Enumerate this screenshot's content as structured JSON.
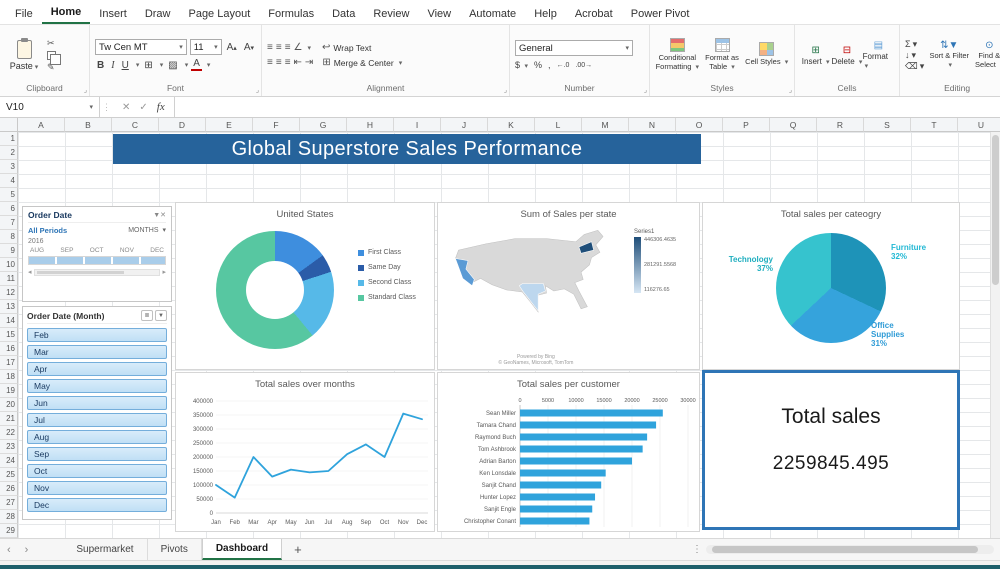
{
  "ribbon": {
    "tabs": [
      {
        "label": "File",
        "active": false
      },
      {
        "label": "Home",
        "active": true
      },
      {
        "label": "Insert",
        "active": false
      },
      {
        "label": "Draw",
        "active": false
      },
      {
        "label": "Page Layout",
        "active": false
      },
      {
        "label": "Formulas",
        "active": false
      },
      {
        "label": "Data",
        "active": false
      },
      {
        "label": "Review",
        "active": false
      },
      {
        "label": "View",
        "active": false
      },
      {
        "label": "Automate",
        "active": false
      },
      {
        "label": "Help",
        "active": false
      },
      {
        "label": "Acrobat",
        "active": false
      },
      {
        "label": "Power Pivot",
        "active": false
      }
    ],
    "clipboard": {
      "paste_label": "Paste",
      "group_label": "Clipboard"
    },
    "font": {
      "font_name": "Tw Cen MT",
      "font_size": "11",
      "group_label": "Font"
    },
    "alignment": {
      "wrap_text_label": "Wrap Text",
      "merge_center_label": "Merge & Center",
      "group_label": "Alignment"
    },
    "number": {
      "format_value": "General",
      "group_label": "Number"
    },
    "styles": {
      "conditional_label": "Conditional Formatting",
      "format_table_label": "Format as Table",
      "cell_styles_label": "Cell Styles",
      "group_label": "Styles"
    },
    "cells": {
      "insert_label": "Insert",
      "delete_label": "Delete",
      "format_label": "Format",
      "group_label": "Cells"
    },
    "editing": {
      "sort_filter_label": "Sort & Filter",
      "find_select_label": "Find & Select",
      "group_label": "Editing"
    }
  },
  "formula_bar": {
    "name_box_value": "V10",
    "fx_label": "fx"
  },
  "grid": {
    "columns": [
      "A",
      "B",
      "C",
      "D",
      "E",
      "F",
      "G",
      "H",
      "I",
      "J",
      "K",
      "L",
      "M",
      "N",
      "O",
      "P",
      "Q",
      "R",
      "S",
      "T",
      "U"
    ],
    "row_count": 29
  },
  "dashboard": {
    "banner_title": "Global Superstore Sales Performance",
    "timeline": {
      "title": "Order Date",
      "period_label": "All Periods",
      "level_label": "MONTHS",
      "year_label": "2016",
      "months": [
        "AUG",
        "SEP",
        "OCT",
        "NOV",
        "DEC"
      ]
    },
    "slicer": {
      "title": "Order Date (Month)",
      "items": [
        "Feb",
        "Mar",
        "Apr",
        "May",
        "Jun",
        "Jul",
        "Aug",
        "Sep",
        "Oct",
        "Nov",
        "Dec"
      ]
    },
    "total_card": {
      "title": "Total sales",
      "value": "2259845.495"
    }
  },
  "chart_data": [
    {
      "type": "pie",
      "subtype": "donut",
      "title": "United States",
      "labels": [
        "First Class",
        "Same Day",
        "Second Class",
        "Standard Class"
      ],
      "values": [
        15,
        5,
        19,
        61
      ],
      "values_note": "percent, estimated from arc lengths",
      "colors": [
        "#3e8ede",
        "#2b5ca8",
        "#56b9e8",
        "#57c7a1"
      ],
      "legend_position": "right"
    },
    {
      "type": "heatmap",
      "subtype": "filled-map",
      "title": "Sum of Sales per state",
      "legend_title": "Series1",
      "scale_labels": [
        "446306.4635",
        "281291.5568",
        "116276.65"
      ],
      "scale_colors": [
        "#1f4e79",
        "#d6e6f4"
      ],
      "state_colors": {
        "base": "#d9d9d9",
        "california": "#5b9bd5",
        "texas": "#bdd7ee",
        "new_york": "#1f4e79"
      },
      "attribution": "Powered by Bing",
      "copyright": "© GeoNames, Microsoft, TomTom"
    },
    {
      "type": "pie",
      "title": "Total sales per cateogry",
      "labels": [
        "Furniture",
        "Office Supplies",
        "Technology"
      ],
      "values": [
        32,
        31,
        37
      ],
      "colors": [
        "#1e93b8",
        "#35a3dc",
        "#36c3ce"
      ],
      "label_colors": [
        "#22b8d4",
        "#2e9bd6",
        "#1faebf"
      ]
    },
    {
      "type": "line",
      "title": "Total sales over months",
      "x": [
        "Jan",
        "Feb",
        "Mar",
        "Apr",
        "May",
        "Jun",
        "Jul",
        "Aug",
        "Sep",
        "Oct",
        "Nov",
        "Dec"
      ],
      "values": [
        100000,
        55000,
        200000,
        130000,
        155000,
        145000,
        150000,
        210000,
        245000,
        200000,
        355000,
        335000
      ],
      "values_note": "estimated from gridlines",
      "ylim": [
        0,
        400000
      ],
      "ytick_step": 50000,
      "color": "#2fa3dc",
      "grid": true,
      "legend_position": "none"
    },
    {
      "type": "bar",
      "orientation": "horizontal",
      "title": "Total sales per customer",
      "categories": [
        "Sean Miller",
        "Tamara Chand",
        "Raymond Buch",
        "Tom Ashbrook",
        "Adrian Barton",
        "Ken Lonsdale",
        "Sanjit Chand",
        "Hunter Lopez",
        "Sanjit Engle",
        "Christopher Conant"
      ],
      "values": [
        25500,
        24300,
        22700,
        21900,
        20000,
        15300,
        14500,
        13400,
        12900,
        12400
      ],
      "values_note": "estimated from gridlines",
      "xlim": [
        0,
        30000
      ],
      "xticks": [
        0,
        5000,
        10000,
        15000,
        20000,
        25000,
        30000
      ],
      "color": "#2fa3dc",
      "grid": true
    }
  ],
  "sheet_bar": {
    "tabs": [
      {
        "label": "Supermarket",
        "active": false
      },
      {
        "label": "Pivots",
        "active": false
      },
      {
        "label": "Dashboard",
        "active": true
      }
    ],
    "add_label": "+"
  },
  "colors": {
    "banner_bg": "#26639b",
    "accent_green": "#217346",
    "slicer_item_bg": "#c9e3f5",
    "slicer_item_border": "#74aedb",
    "total_border": "#2e75b6",
    "chart_blue": "#2fa3dc"
  }
}
